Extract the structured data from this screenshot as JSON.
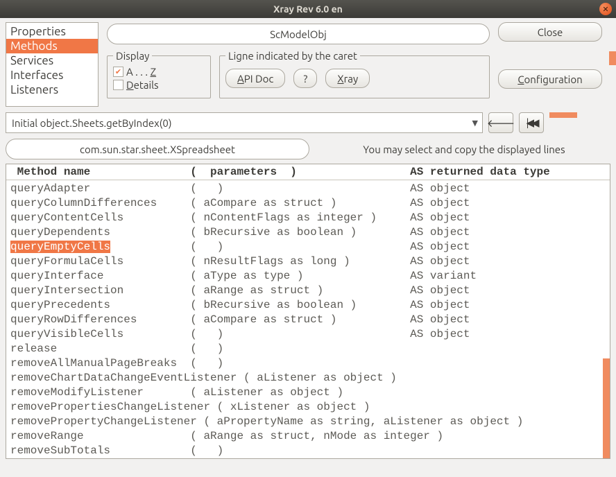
{
  "window": {
    "title": "Xray   Rev 6.0 en"
  },
  "nav": {
    "items": [
      "Properties",
      "Methods",
      "Services",
      "Interfaces",
      "Listeners"
    ],
    "selected": 1
  },
  "object_name": "ScModelObj",
  "buttons": {
    "close": "Close",
    "configuration": "Configuration",
    "api_doc_pre": "A",
    "api_doc_post": "PI Doc",
    "xray_pre": "X",
    "xray_post": "ray",
    "question": "?"
  },
  "display": {
    "legend": "Display",
    "az_label_pre": "A . . . ",
    "az_label_u": "Z",
    "az_checked": true,
    "details_label_u": "D",
    "details_label_post": "etails",
    "details_checked": false
  },
  "caret": {
    "legend": "Ligne indicated by the caret"
  },
  "path": "Initial object.Sheets.getByIndex(0)",
  "interface": "com.sun.star.sheet.XSpreadsheet",
  "hint": "You may select and copy the displayed lines",
  "header": " Method name               (  parameters  )                 AS returned data type",
  "rows": [
    {
      "n": "queryAdapter",
      "p": "(   )",
      "r": "AS object"
    },
    {
      "n": "queryColumnDifferences",
      "p": "( aCompare as struct )",
      "r": "AS object"
    },
    {
      "n": "queryContentCells",
      "p": "( nContentFlags as integer )",
      "r": "AS object"
    },
    {
      "n": "queryDependents",
      "p": "( bRecursive as boolean )",
      "r": "AS object"
    },
    {
      "n": "queryEmptyCells",
      "p": "(   )",
      "r": "AS object",
      "hl": true
    },
    {
      "n": "queryFormulaCells",
      "p": "( nResultFlags as long )",
      "r": "AS object"
    },
    {
      "n": "queryInterface",
      "p": "( aType as type )",
      "r": "AS variant"
    },
    {
      "n": "queryIntersection",
      "p": "( aRange as struct )",
      "r": "AS object"
    },
    {
      "n": "queryPrecedents",
      "p": "( bRecursive as boolean )",
      "r": "AS object"
    },
    {
      "n": "queryRowDifferences",
      "p": "( aCompare as struct )",
      "r": "AS object"
    },
    {
      "n": "queryVisibleCells",
      "p": "(   )",
      "r": "AS object"
    },
    {
      "n": "release",
      "p": "(   )",
      "r": ""
    },
    {
      "n": "removeAllManualPageBreaks",
      "p": "(   )",
      "r": ""
    },
    {
      "full": "removeChartDataChangeEventListener ( aListener as object )"
    },
    {
      "n": "removeModifyListener",
      "p": "( aListener as object )",
      "r": ""
    },
    {
      "full": "removePropertiesChangeListener ( xListener as object )"
    },
    {
      "full": "removePropertyChangeListener ( aPropertyName as string, aListener as object )"
    },
    {
      "n": "removeRange",
      "p": "( aRange as struct, nMode as integer )",
      "r": ""
    },
    {
      "n": "removeSubTotals",
      "p": "(   )",
      "r": ""
    }
  ]
}
